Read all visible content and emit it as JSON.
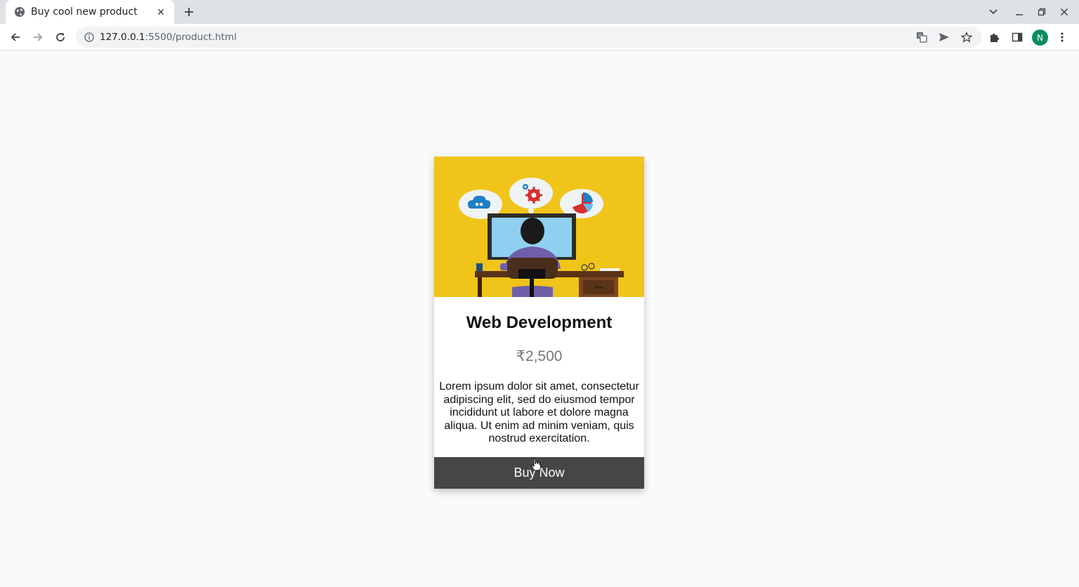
{
  "browser": {
    "tab_title": "Buy cool new product",
    "url_host": "127.0.0.1",
    "url_path": ":5500/product.html",
    "profile_initial": "N",
    "profile_color": "#0b8d5e"
  },
  "product": {
    "title": "Web Development",
    "price": "₹2,500",
    "description": "Lorem ipsum dolor sit amet, consectetur adipiscing elit, sed do eiusmod tempor incididunt ut labore et dolore magna aliqua. Ut enim ad minim veniam, quis nostrud exercitation.",
    "button_label": "Buy Now",
    "image_icon": "developer-at-desk-illustration",
    "accent_color": "#f0c419",
    "button_color": "#464646"
  }
}
